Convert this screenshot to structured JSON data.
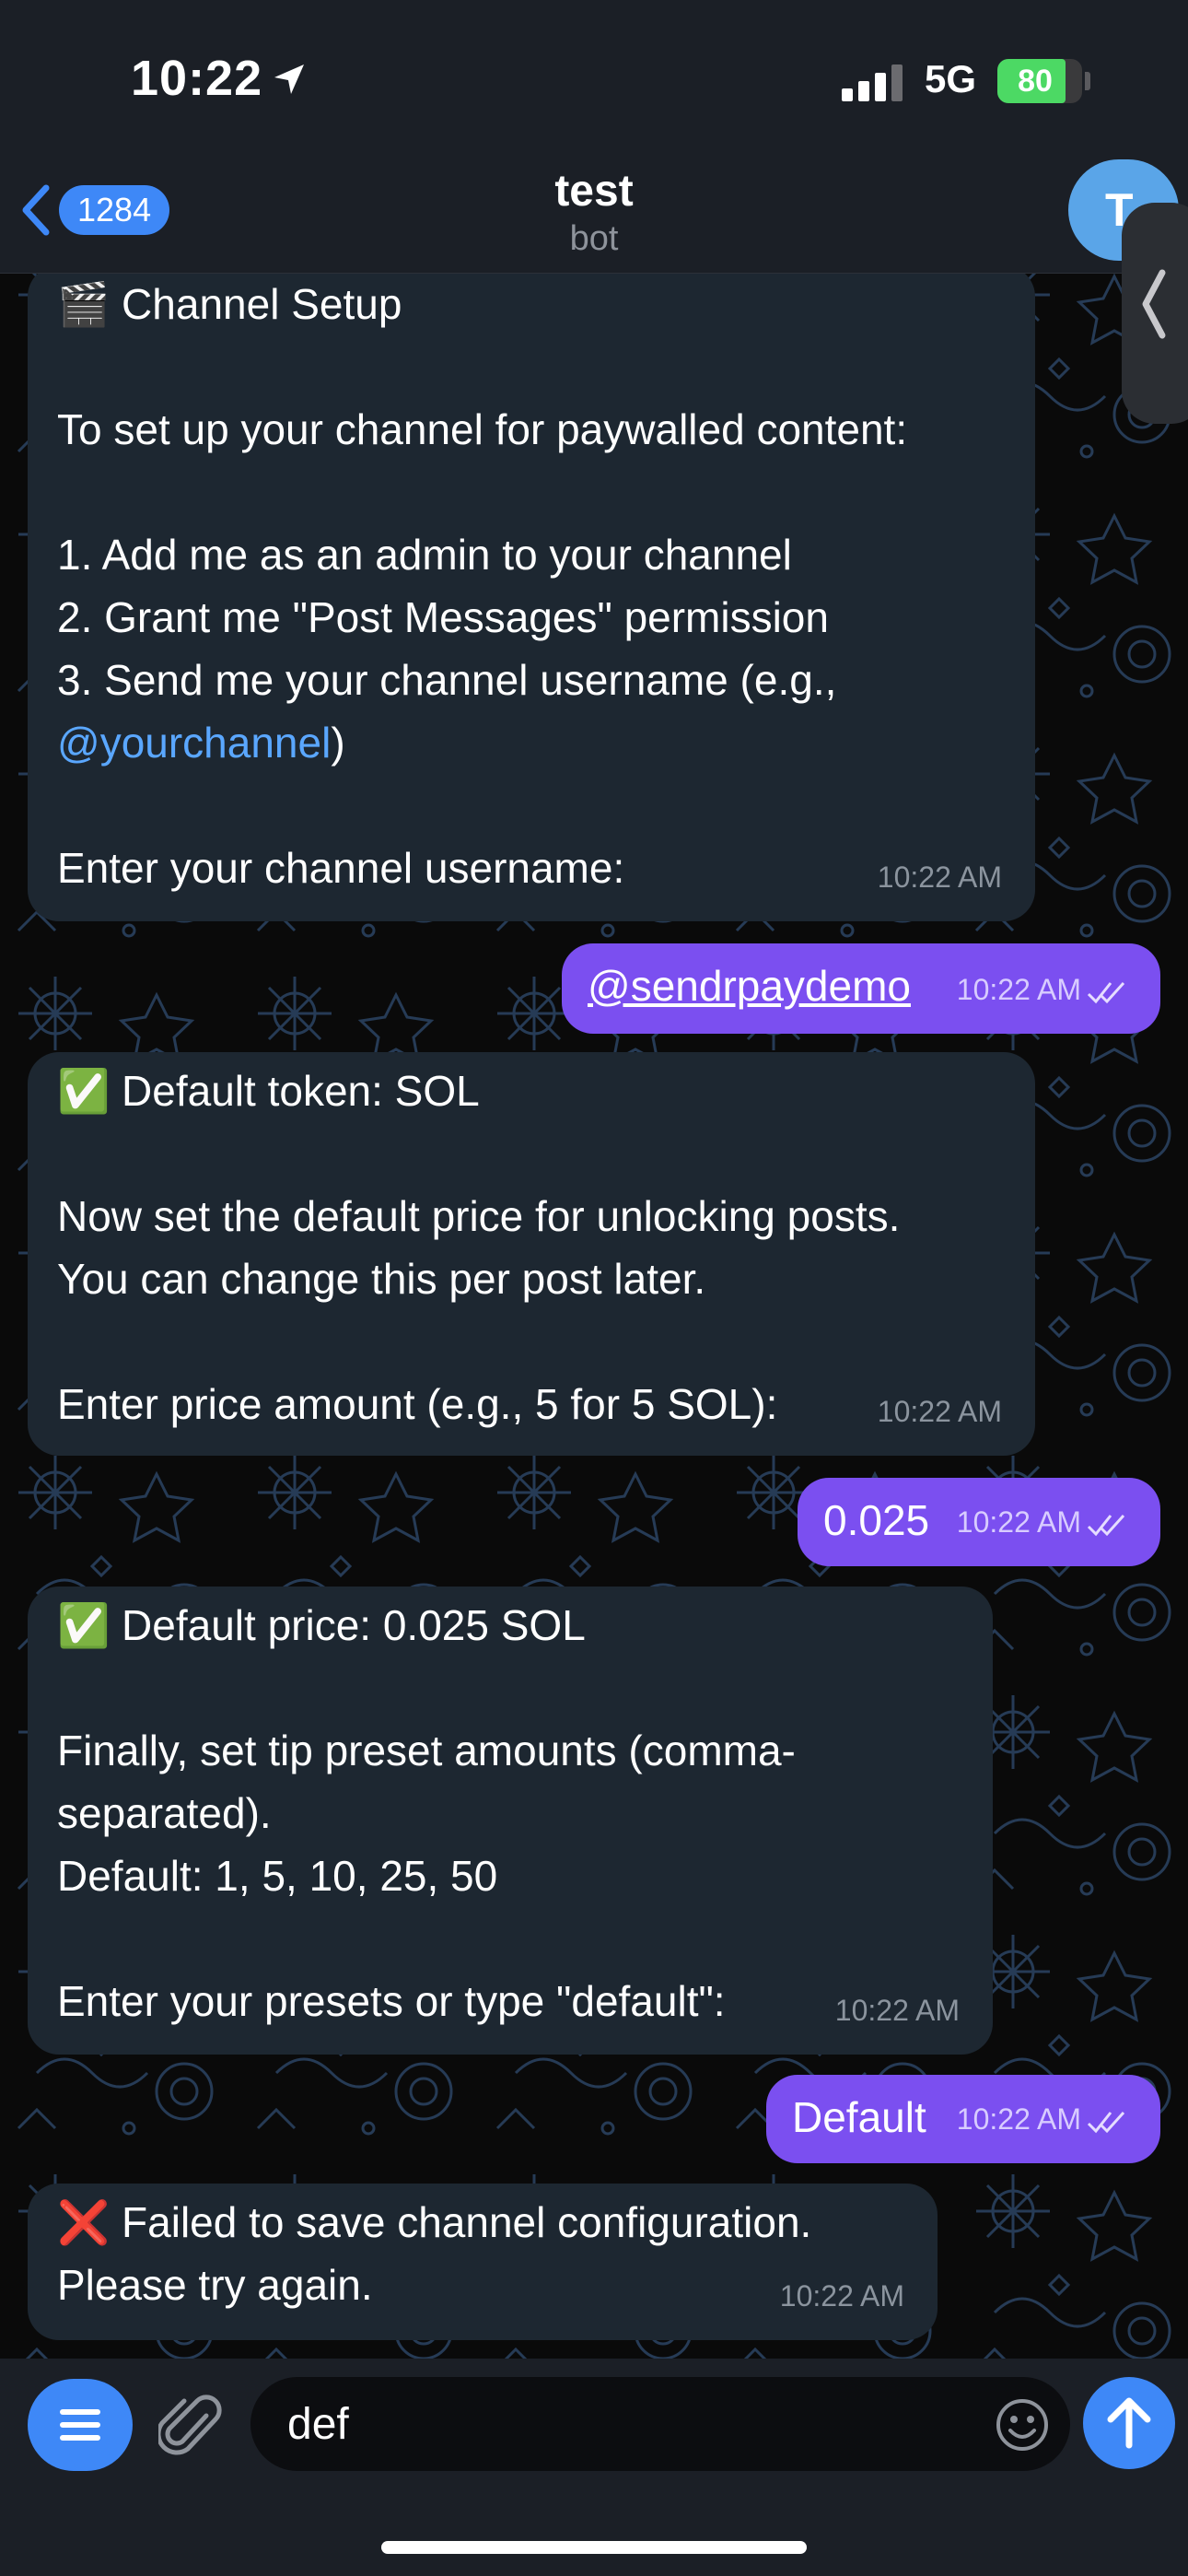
{
  "status_bar": {
    "time": "10:22",
    "network": "5G",
    "battery": "80",
    "battery_level": 0.8
  },
  "header": {
    "back_count": "1284",
    "title": "test",
    "subtitle": "bot",
    "avatar_initial": "T"
  },
  "messages": [
    {
      "dir": "in",
      "text_1": "🎬 Channel Setup\n\nTo set up your channel for paywalled content:\n\n1. Add me as an admin to your channel\n2. Grant me \"Post Messages\" permission\n3. Send me your channel username (e.g.,\n",
      "mention": "@yourchannel",
      "text_2": ")\n\nEnter your channel username:",
      "time": "10:22 AM"
    },
    {
      "dir": "out",
      "text": "@sendrpaydemo",
      "time": "10:22 AM"
    },
    {
      "dir": "in",
      "text": "✅ Default token: SOL\n\nNow set the default price for unlocking posts.\nYou can change this per post later.\n\nEnter price amount (e.g., 5 for 5 SOL):",
      "time": "10:22 AM"
    },
    {
      "dir": "out",
      "text": "0.025",
      "time": "10:22 AM"
    },
    {
      "dir": "in",
      "text": "✅ Default price: 0.025 SOL\n\nFinally, set tip preset amounts (comma-\nseparated).\nDefault: 1, 5, 10, 25, 50\n\nEnter your presets or type \"default\":",
      "time": "10:22 AM"
    },
    {
      "dir": "out",
      "text": "Default",
      "time": "10:22 AM"
    },
    {
      "dir": "in",
      "text": "❌ Failed to save channel configuration.\nPlease try again.",
      "time": "10:22 AM"
    }
  ],
  "composer": {
    "value": "def"
  },
  "colors": {
    "accent": "#3e88f7",
    "outgoing_bubble": "#7b4ff0",
    "incoming_bubble": "#1d2731",
    "link": "#5aa7ff"
  },
  "icons": [
    "location-arrow-icon",
    "signal-icon",
    "battery-icon",
    "back-chevron-icon",
    "side-chevron-icon",
    "read-ticks-icon",
    "menu-icon",
    "attach-icon",
    "emoji-icon",
    "send-arrow-icon"
  ]
}
